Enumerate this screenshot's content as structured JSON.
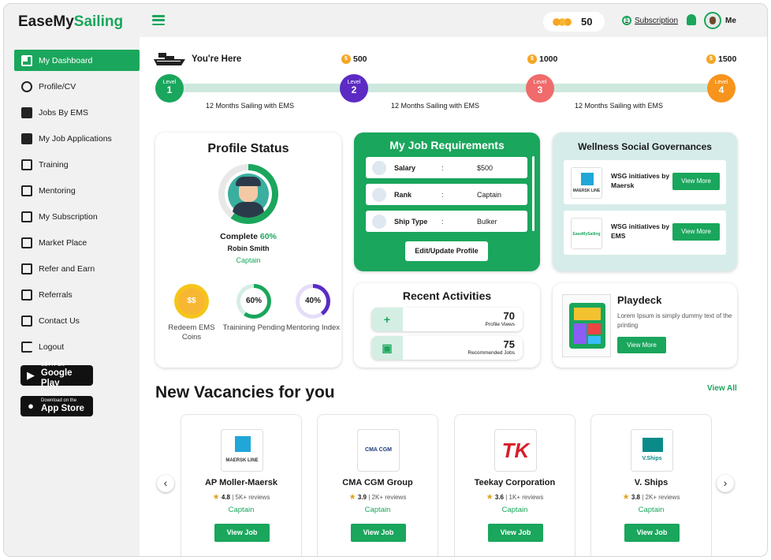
{
  "brand": {
    "prefix": "EaseMy",
    "accent": "Sailing"
  },
  "sidebar": {
    "items": [
      {
        "label": "My Dashboard",
        "icon": "dashboard-icon"
      },
      {
        "label": "Profile/CV",
        "icon": "profile-icon"
      },
      {
        "label": "Jobs By EMS",
        "icon": "briefcase-icon"
      },
      {
        "label": "My Job Applications",
        "icon": "applications-icon"
      },
      {
        "label": "Training",
        "icon": "training-icon"
      },
      {
        "label": "Mentoring",
        "icon": "mentoring-icon"
      },
      {
        "label": "My Subscription",
        "icon": "subscription-icon"
      },
      {
        "label": "Market Place",
        "icon": "market-icon"
      },
      {
        "label": "Refer and Earn",
        "icon": "gift-icon"
      },
      {
        "label": "Referrals",
        "icon": "referrals-icon"
      },
      {
        "label": "Contact Us",
        "icon": "contact-icon"
      },
      {
        "label": "Logout",
        "icon": "logout-icon"
      }
    ],
    "google_play": {
      "small": "GET IT ON",
      "big": "Google Play"
    },
    "app_store": {
      "small": "Download on the",
      "big": "App Store"
    }
  },
  "topbar": {
    "coins": "50",
    "subscription": "Subscription",
    "user": "Me"
  },
  "progress": {
    "you_here": "You're Here",
    "levels": [
      {
        "word": "Level",
        "num": "1",
        "color": "#1aa65c"
      },
      {
        "word": "Level",
        "num": "2",
        "color": "#5b2bc4"
      },
      {
        "word": "Level",
        "num": "3",
        "color": "#f06b6b"
      },
      {
        "word": "Level",
        "num": "4",
        "color": "#f7941d"
      }
    ],
    "costs": [
      "500",
      "1000",
      "1500"
    ],
    "segment": "12 Months Sailing with EMS"
  },
  "profile_status": {
    "title": "Profile Status",
    "complete_label": "Complete",
    "complete_value": "60%",
    "complete_fraction": 0.6,
    "name": "Robin Smith",
    "rank": "Captain",
    "stats": [
      {
        "value": "",
        "label": "Redeem EMS Coins"
      },
      {
        "value": "60%",
        "label": "Trainining Pending",
        "fraction": 0.6
      },
      {
        "value": "40%",
        "label": "Mentoring Index",
        "fraction": 0.4
      }
    ]
  },
  "job_requirements": {
    "title": "My Job Requirements",
    "rows": [
      {
        "key": "Salary",
        "sep": ":",
        "value": "$500"
      },
      {
        "key": "Rank",
        "sep": ":",
        "value": "Captain"
      },
      {
        "key": "Ship Type",
        "sep": ":",
        "value": "Bulker"
      }
    ],
    "edit_button": "Edit/Update Profile"
  },
  "wsg": {
    "title": "Wellness Social Governances",
    "items": [
      {
        "logo_text": "MAERSK LINE",
        "text": "WSG initiatives by Maersk",
        "button": "View More"
      },
      {
        "logo_text": "EaseMySailing",
        "text": "WSG initiatives by EMS",
        "button": "View More"
      }
    ]
  },
  "recent": {
    "title": "Recent Activities",
    "rows": [
      {
        "icon": "add-user-icon",
        "glyph": "+",
        "value": "70",
        "label": "Profile Views"
      },
      {
        "icon": "briefcase-icon",
        "glyph": "▣",
        "value": "75",
        "label": "Recommended Jobs"
      }
    ]
  },
  "playdeck": {
    "title": "Playdeck",
    "desc": "Lorem Ipsum is simply dummy text of the printing",
    "button": "View More"
  },
  "vacancies": {
    "title": "New Vacancies for you",
    "view_all": "View All",
    "cards": [
      {
        "logo": "MAERSK LINE",
        "logo_color": "#21a6d8",
        "name": "AP Moller-Maersk",
        "rating": "4.8",
        "reviews": "5K+ reviews",
        "rank": "Captain",
        "button": "View Job"
      },
      {
        "logo": "CMA CGM",
        "logo_color": "#1d3a7a",
        "name": "CMA CGM Group",
        "rating": "3.9",
        "reviews": "2K+ reviews",
        "rank": "Captain",
        "button": "View Job"
      },
      {
        "logo": "TK",
        "logo_color": "#d4202a",
        "name": "Teekay Corporation",
        "rating": "3.6",
        "reviews": "1K+ reviews",
        "rank": "Captain",
        "button": "View Job"
      },
      {
        "logo": "V.Ships",
        "logo_color": "#0b8a8a",
        "name": "V. Ships",
        "rating": "3.8",
        "reviews": "2K+ reviews",
        "rank": "Captain",
        "button": "View Job"
      }
    ]
  }
}
